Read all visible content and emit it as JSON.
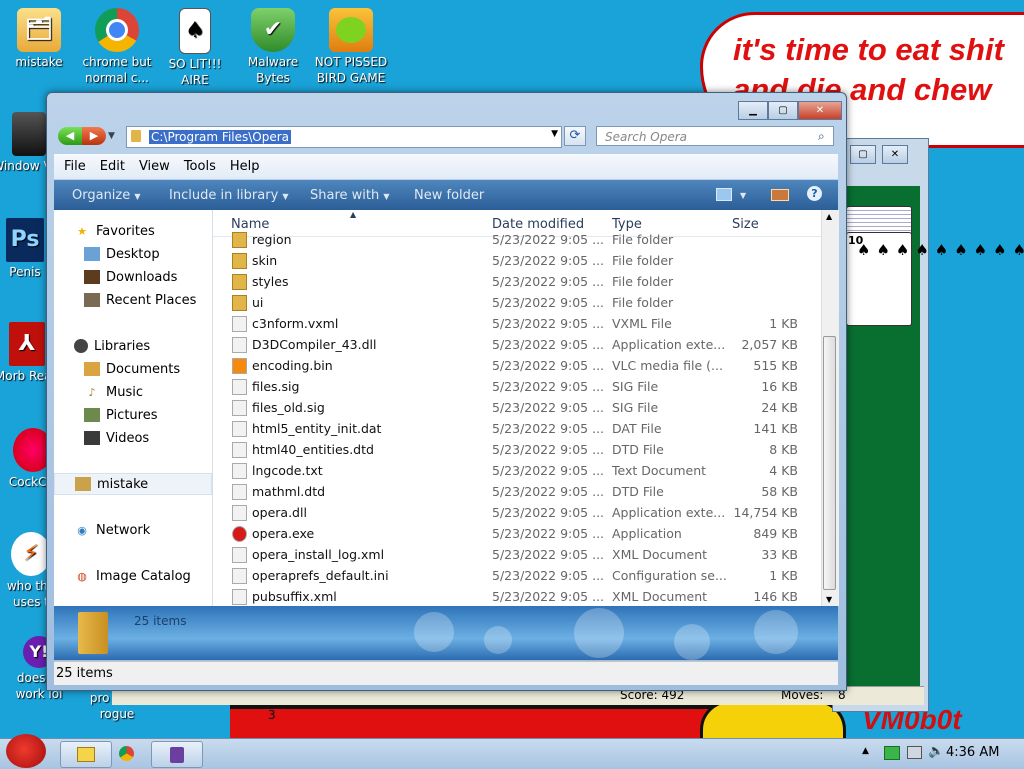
{
  "desktop": {
    "icons": [
      {
        "label": "mistake"
      },
      {
        "label": "chrome but normal c..."
      },
      {
        "label": "SO LIT!!! AIRE"
      },
      {
        "label": "Malware Bytes"
      },
      {
        "label": "NOT PISSED BIRD GAME"
      },
      {
        "label": "Window Vist"
      },
      {
        "label": "Penis"
      },
      {
        "label": "Morb Read"
      },
      {
        "label": "CockCle"
      },
      {
        "label": "who the uses t"
      },
      {
        "label": "doesn't work lol"
      },
      {
        "label": "pro not a rogue"
      }
    ],
    "speech_text": "it's time to eat shit and die and chew gum",
    "bottom_text": "VM0b0t",
    "bottom_number": "3"
  },
  "solitaire": {
    "score_label": "Score: 492",
    "moves_label": "Moves:",
    "moves_value": "8",
    "card_rank": "10"
  },
  "explorer": {
    "address": "C:\\Program Files\\Opera",
    "search_placeholder": "Search Opera",
    "menu": [
      "File",
      "Edit",
      "View",
      "Tools",
      "Help"
    ],
    "commands": [
      "Organize",
      "Include in library",
      "Share with",
      "New folder"
    ],
    "nav": {
      "favorites": "Favorites",
      "desktop": "Desktop",
      "downloads": "Downloads",
      "recent": "Recent Places",
      "libraries": "Libraries",
      "documents": "Documents",
      "music": "Music",
      "pictures": "Pictures",
      "videos": "Videos",
      "user": "mistake",
      "network": "Network",
      "image_catalog": "Image Catalog"
    },
    "columns": {
      "name": "Name",
      "date": "Date modified",
      "type": "Type",
      "size": "Size"
    },
    "files": [
      {
        "name": "region",
        "date": "5/23/2022 9:05 ...",
        "type": "File folder",
        "size": ""
      },
      {
        "name": "skin",
        "date": "5/23/2022 9:05 ...",
        "type": "File folder",
        "size": ""
      },
      {
        "name": "styles",
        "date": "5/23/2022 9:05 ...",
        "type": "File folder",
        "size": ""
      },
      {
        "name": "ui",
        "date": "5/23/2022 9:05 ...",
        "type": "File folder",
        "size": ""
      },
      {
        "name": "c3nform.vxml",
        "date": "5/23/2022 9:05 ...",
        "type": "VXML File",
        "size": "1 KB"
      },
      {
        "name": "D3DCompiler_43.dll",
        "date": "5/23/2022 9:05 ...",
        "type": "Application exte...",
        "size": "2,057 KB"
      },
      {
        "name": "encoding.bin",
        "date": "5/23/2022 9:05 ...",
        "type": "VLC media file (...",
        "size": "515 KB"
      },
      {
        "name": "files.sig",
        "date": "5/23/2022 9:05 ...",
        "type": "SIG File",
        "size": "16 KB"
      },
      {
        "name": "files_old.sig",
        "date": "5/23/2022 9:05 ...",
        "type": "SIG File",
        "size": "24 KB"
      },
      {
        "name": "html5_entity_init.dat",
        "date": "5/23/2022 9:05 ...",
        "type": "DAT File",
        "size": "141 KB"
      },
      {
        "name": "html40_entities.dtd",
        "date": "5/23/2022 9:05 ...",
        "type": "DTD File",
        "size": "8 KB"
      },
      {
        "name": "lngcode.txt",
        "date": "5/23/2022 9:05 ...",
        "type": "Text Document",
        "size": "4 KB"
      },
      {
        "name": "mathml.dtd",
        "date": "5/23/2022 9:05 ...",
        "type": "DTD File",
        "size": "58 KB"
      },
      {
        "name": "opera.dll",
        "date": "5/23/2022 9:05 ...",
        "type": "Application exte...",
        "size": "14,754 KB"
      },
      {
        "name": "opera.exe",
        "date": "5/23/2022 9:05 ...",
        "type": "Application",
        "size": "849 KB"
      },
      {
        "name": "opera_install_log.xml",
        "date": "5/23/2022 9:05 ...",
        "type": "XML Document",
        "size": "33 KB"
      },
      {
        "name": "operaprefs_default.ini",
        "date": "5/23/2022 9:05 ...",
        "type": "Configuration se...",
        "size": "1 KB"
      },
      {
        "name": "pubsuffix.xml",
        "date": "5/23/2022 9:05 ...",
        "type": "XML Document",
        "size": "146 KB"
      }
    ],
    "details_count": "25 items",
    "status_count": "25 items"
  },
  "taskbar": {
    "clock": "4:36 AM"
  }
}
